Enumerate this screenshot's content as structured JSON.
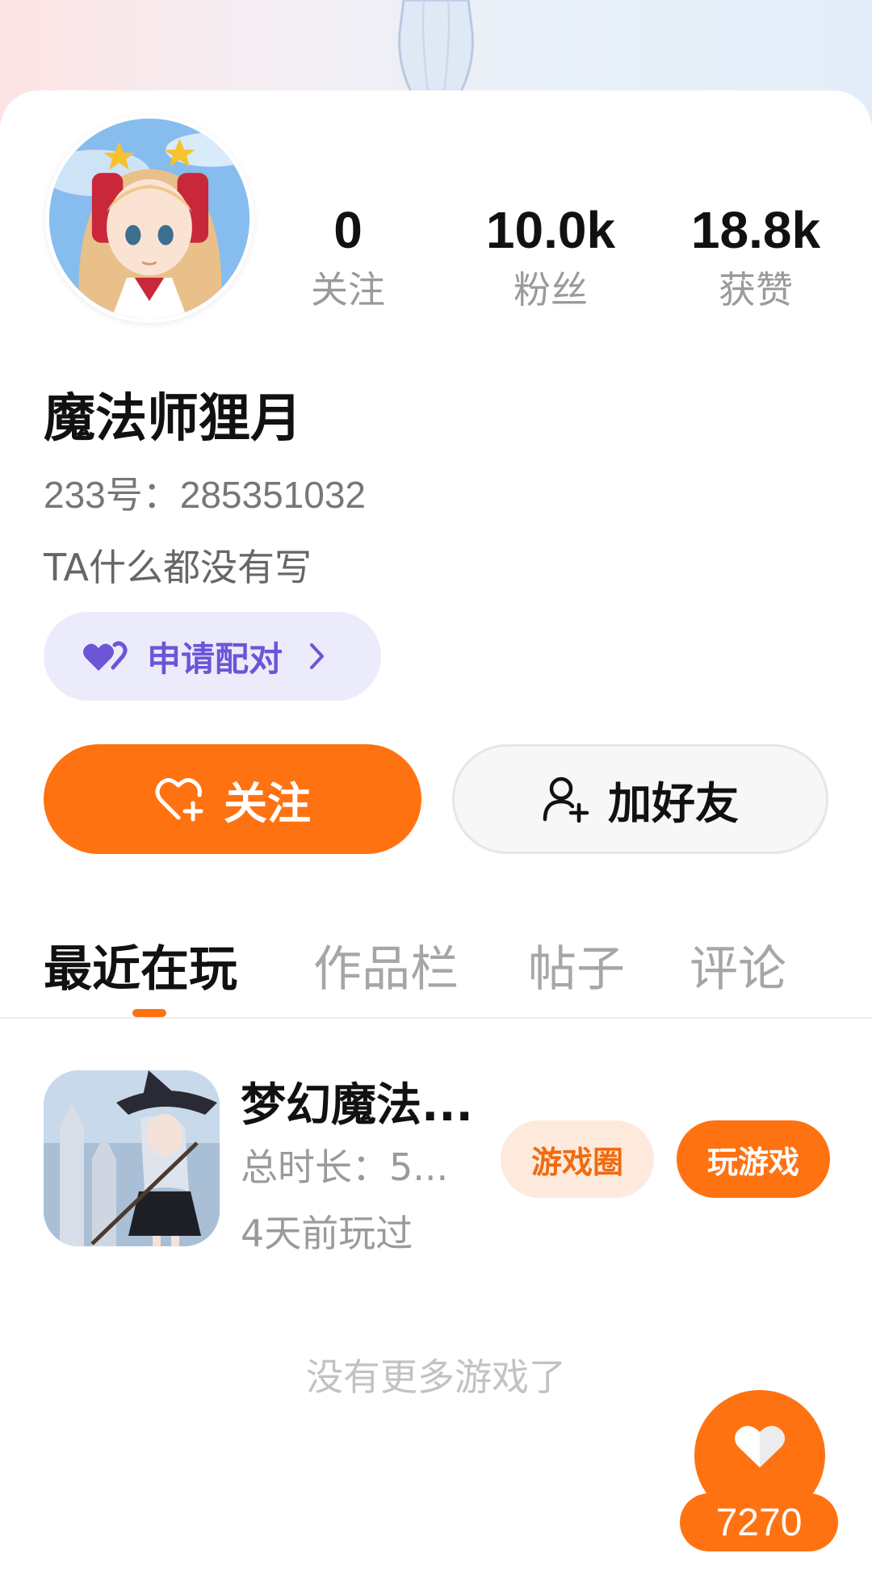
{
  "profile": {
    "nickname": "魔法师狸月",
    "uid": "233号：285351032",
    "bio": "TA什么都没有写"
  },
  "stats": [
    {
      "value": "0",
      "label": "关注"
    },
    {
      "value": "10.0k",
      "label": "粉丝"
    },
    {
      "value": "18.8k",
      "label": "获赞"
    }
  ],
  "actions": {
    "pair_label": "申请配对",
    "follow_label": "关注",
    "add_friend_label": "加好友"
  },
  "tabs": [
    {
      "label": "最近在玩",
      "active": true
    },
    {
      "label": "作品栏",
      "active": false
    },
    {
      "label": "帖子",
      "active": false
    },
    {
      "label": "评论",
      "active": false
    }
  ],
  "recent_game": {
    "title": "梦幻魔法...",
    "duration": "总时长：5...",
    "last_played": "4天前玩过",
    "circle_label": "游戏圈",
    "play_label": "玩游戏"
  },
  "empty_hint": "没有更多游戏了",
  "like_fab": {
    "count": "7270",
    "icon": "heart-icon"
  },
  "colors": {
    "accent": "#ff7212",
    "pair_purple": "#6d55d6",
    "pair_bg": "#ecebfb"
  }
}
